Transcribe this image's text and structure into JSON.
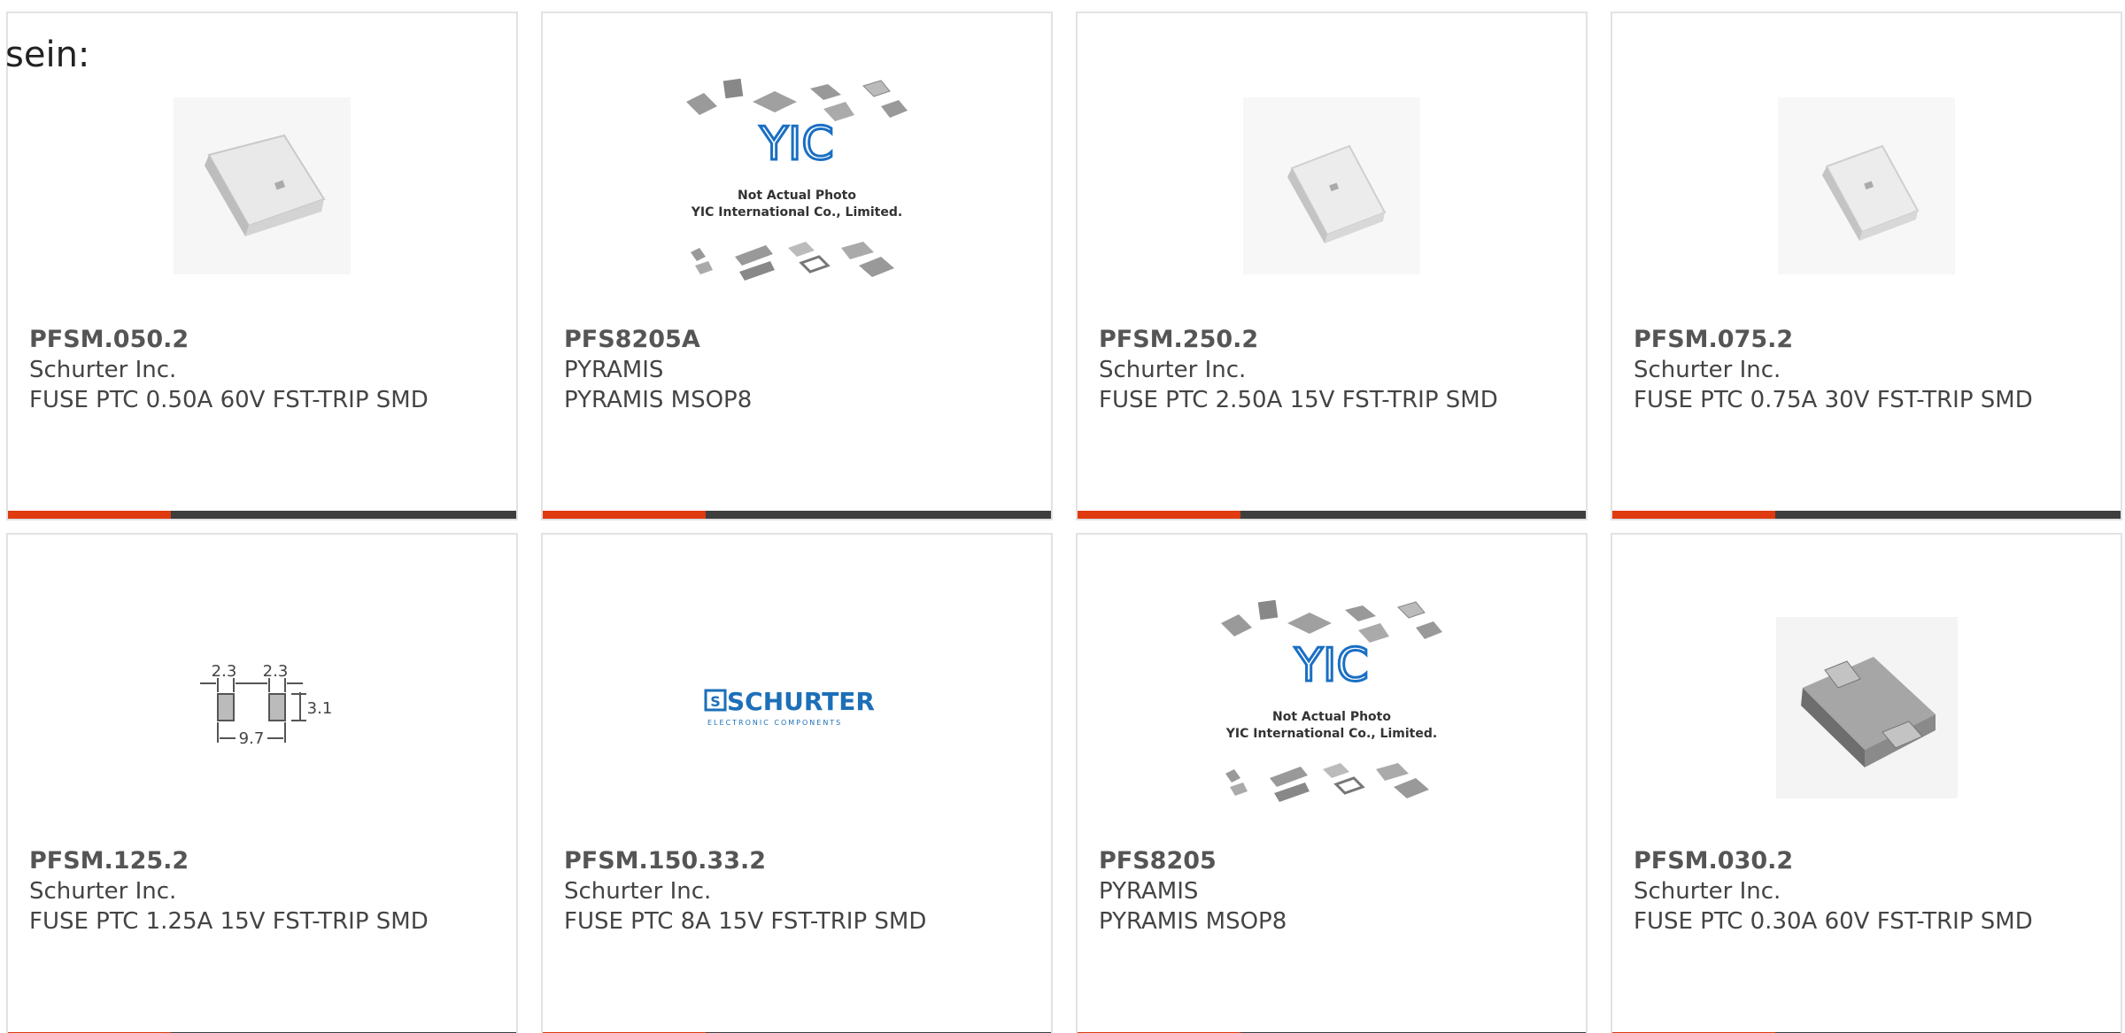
{
  "intro_text": "sein:",
  "products": [
    {
      "part": "PFSM.050.2",
      "maker": "Schurter Inc.",
      "desc": "FUSE PTC 0.50A 60V FST-TRIP SMD",
      "image": "ptc-fuse-photo"
    },
    {
      "part": "PFS8205A",
      "maker": "PYRAMIS",
      "desc": "PYRAMIS MSOP8",
      "image": "yic-placeholder",
      "placeholder_line1": "Not Actual Photo",
      "placeholder_line2": "YIC International Co., Limited."
    },
    {
      "part": "PFSM.250.2",
      "maker": "Schurter Inc.",
      "desc": "FUSE PTC 2.50A 15V FST-TRIP SMD",
      "image": "ptc-fuse-photo"
    },
    {
      "part": "PFSM.075.2",
      "maker": "Schurter Inc.",
      "desc": "FUSE PTC 0.75A 30V FST-TRIP SMD",
      "image": "ptc-fuse-photo"
    },
    {
      "part": "PFSM.125.2",
      "maker": "Schurter Inc.",
      "desc": "FUSE PTC 1.25A 15V FST-TRIP SMD",
      "image": "footprint-diagram",
      "dims": [
        "2.3",
        "2.3",
        "3.1",
        "9.7"
      ]
    },
    {
      "part": "PFSM.150.33.2",
      "maker": "Schurter Inc.",
      "desc": "FUSE PTC 8A 15V FST-TRIP SMD",
      "image": "schurter-logo",
      "logo_text": "SCHURTER",
      "logo_sub": "ELECTRONIC COMPONENTS"
    },
    {
      "part": "PFS8205",
      "maker": "PYRAMIS",
      "desc": "PYRAMIS MSOP8",
      "image": "yic-placeholder",
      "placeholder_line1": "Not Actual Photo",
      "placeholder_line2": "YIC International Co., Limited."
    },
    {
      "part": "PFSM.030.2",
      "maker": "Schurter Inc.",
      "desc": "FUSE PTC 0.30A 60V FST-TRIP SMD",
      "image": "ptc-fuse-dark-photo"
    }
  ],
  "colors": {
    "accent": "#e03a10",
    "bar": "#3e3e3e",
    "border": "#e2e2e2",
    "yic_blue": "#1a6fc4",
    "schurter_blue": "#1c6fb8"
  }
}
